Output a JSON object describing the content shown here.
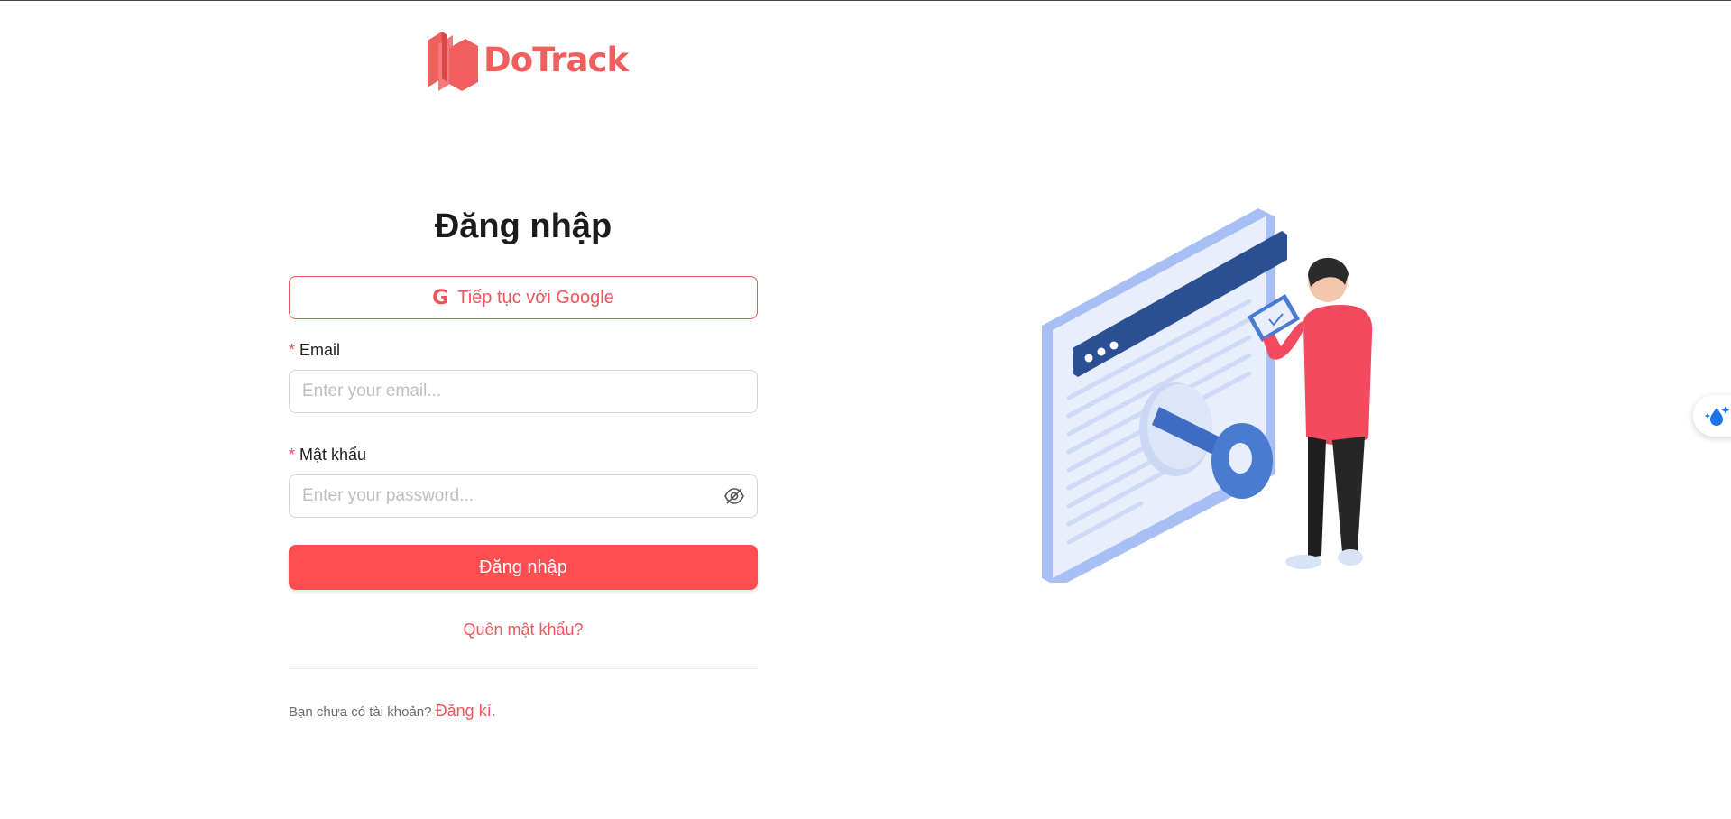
{
  "brand": {
    "name": "DoTrack",
    "color": "#f15e5e"
  },
  "login": {
    "title": "Đăng nhập",
    "google_button": "Tiếp tục với Google",
    "email_label": "Email",
    "email_placeholder": "Enter your email...",
    "password_label": "Mật khẩu",
    "password_placeholder": "Enter your password...",
    "submit_label": "Đăng nhập",
    "forgot_link": "Quên mật khẩu?",
    "signup_prompt": "Bạn chưa có tài khoản?",
    "signup_link": "Đăng kí.",
    "required_mark": "*"
  },
  "icons": {
    "google": "google-icon",
    "password_toggle": "eye-off-icon",
    "floating": "water-drop-sparkle-icon"
  },
  "colors": {
    "accent": "#ff4d52",
    "link": "#f2545b",
    "illustration_blue": "#4a7bd0",
    "illustration_red": "#f44a5f"
  }
}
